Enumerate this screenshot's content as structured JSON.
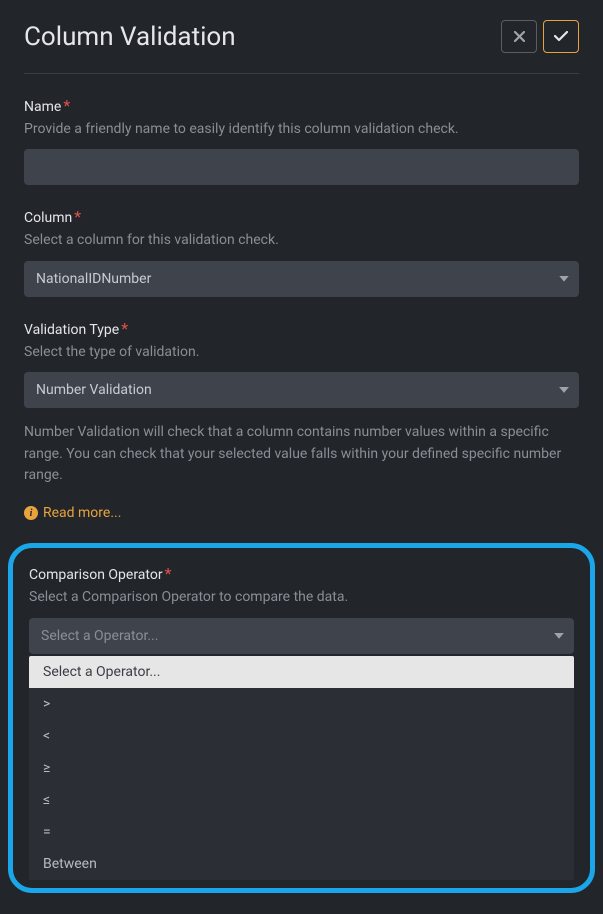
{
  "header": {
    "title": "Column Validation"
  },
  "fields": {
    "name": {
      "label": "Name",
      "help": "Provide a friendly name to easily identify this column validation check.",
      "value": ""
    },
    "column": {
      "label": "Column",
      "help": "Select a column for this validation check.",
      "value": "NationalIDNumber"
    },
    "validationType": {
      "label": "Validation Type",
      "help": "Select the type of validation.",
      "value": "Number Validation",
      "description": "Number Validation will check that a column contains number values within a specific range. You can check that your selected value falls within your defined specific number range.",
      "readMore": "Read more..."
    },
    "comparison": {
      "label": "Comparison Operator",
      "help": "Select a Comparison Operator to compare the data.",
      "placeholder": "Select a Operator...",
      "options": {
        "o0": "Select a Operator...",
        "o1": ">",
        "o2": "<",
        "o3": "≥",
        "o4": "≤",
        "o5": "=",
        "o6": "Between"
      }
    }
  }
}
